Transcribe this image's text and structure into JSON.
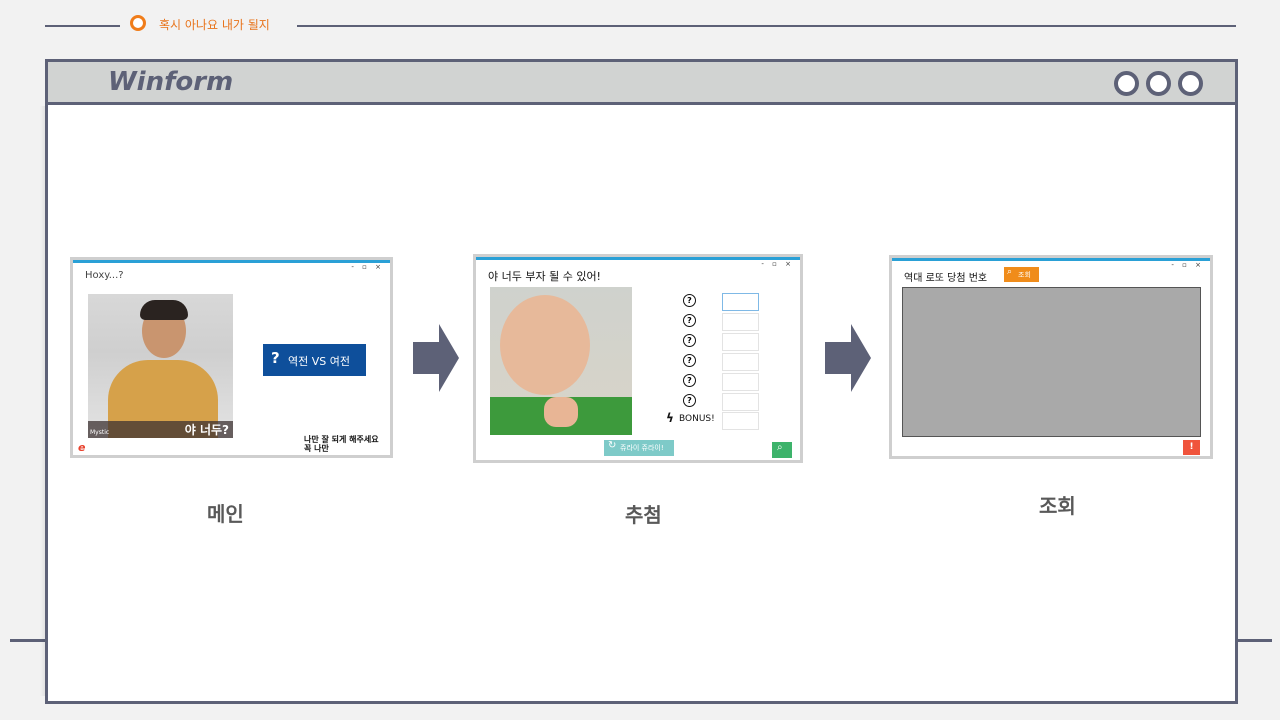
{
  "header": {
    "tagline": "혹시 아나요 내가 될지"
  },
  "window": {
    "title": "Winform"
  },
  "screens": {
    "main": {
      "caption": "메인",
      "title": "Hoxy...?",
      "button_label": "역전 VS 여전",
      "photo_caption": "야 너두?",
      "photo_watermark": "Mystic",
      "footer_text_1": "나만 잘 되게 해주세요",
      "footer_text_2": "꼭 나만"
    },
    "recommend": {
      "caption": "추첨",
      "title": "야 너두 부자 될 수 있어!",
      "bonus_label": "BONUS!",
      "refresh_label": "쥬라이 쥬라이!"
    },
    "lookup": {
      "caption": "조회",
      "title": "역대 로또 당첨 번호",
      "search_label": "조회"
    }
  },
  "colors": {
    "accent_orange": "#f07d1a",
    "frame": "#5d6177",
    "blue_button": "#0e4f9b",
    "teal_button": "#7ecac8",
    "green_button": "#3db36b",
    "red_button": "#f0543c",
    "grid_gray": "#a9a9a9"
  }
}
